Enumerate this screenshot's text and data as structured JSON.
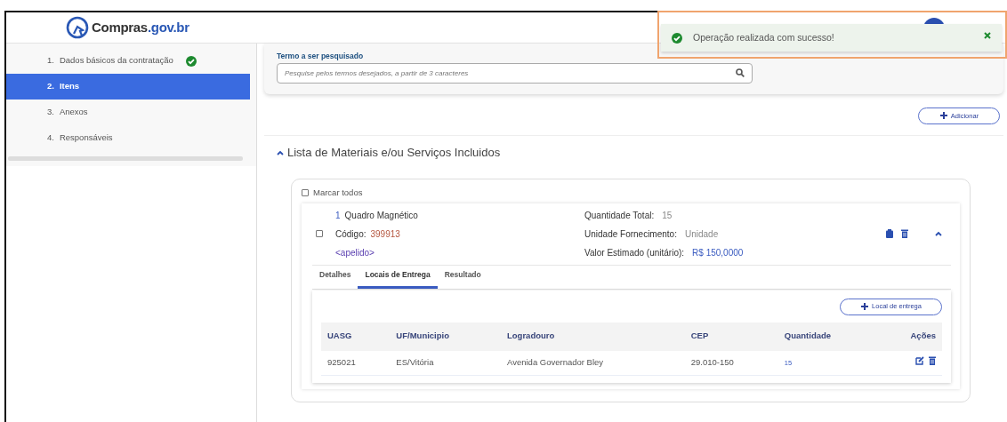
{
  "logo": {
    "name": "Compras",
    "domain": ".gov.br"
  },
  "toast": {
    "message": "Operação realizada com sucesso!"
  },
  "steps": [
    {
      "number": "1.",
      "label": "Dados básicos da contratação",
      "selected": false,
      "completed": true
    },
    {
      "number": "2.",
      "label": "Itens",
      "selected": true,
      "completed": false
    },
    {
      "number": "3.",
      "label": "Anexos",
      "selected": false,
      "completed": false
    },
    {
      "number": "4.",
      "label": "Responsáveis",
      "selected": false,
      "completed": false
    }
  ],
  "search": {
    "label": "Termo a ser pesquisado",
    "placeholder": "Pesquise pelos termos desejados, a partir de 3 caracteres"
  },
  "add_button": "Adicionar",
  "list": {
    "title": "Lista de Materiais e/ou Serviços Incluidos",
    "expanded": true,
    "select_all": {
      "label": "Marcar todos",
      "checked": false
    },
    "items": [
      {
        "number": "1",
        "name": "Quadro Magnético",
        "checked": false,
        "code_label": "Código:",
        "code": "399913",
        "alias": "<apelido>",
        "expanded": true,
        "details": [
          {
            "label": "Quantidade Total:",
            "value": "15",
            "kind": "plain"
          },
          {
            "label": "Unidade Fornecimento:",
            "value": "Unidade",
            "kind": "plain"
          },
          {
            "label": "Valor Estimado (unitário):",
            "value": "R$ 150,0000",
            "kind": "money"
          }
        ],
        "tabs": [
          {
            "label": "Detalhes",
            "selected": false
          },
          {
            "label": "Locais de Entrega",
            "selected": true
          },
          {
            "label": "Resultado",
            "selected": false
          }
        ],
        "add_location_button": "Local de entrega",
        "table": {
          "columns": [
            "UASG",
            "UF/Municipio",
            "Logradouro",
            "CEP",
            "Quantidade",
            "Ações"
          ],
          "rows": [
            {
              "cells": [
                "925021",
                "ES/Vitória",
                "Avenida Governador Bley",
                "29.010-150",
                "15"
              ]
            }
          ]
        }
      }
    ]
  }
}
